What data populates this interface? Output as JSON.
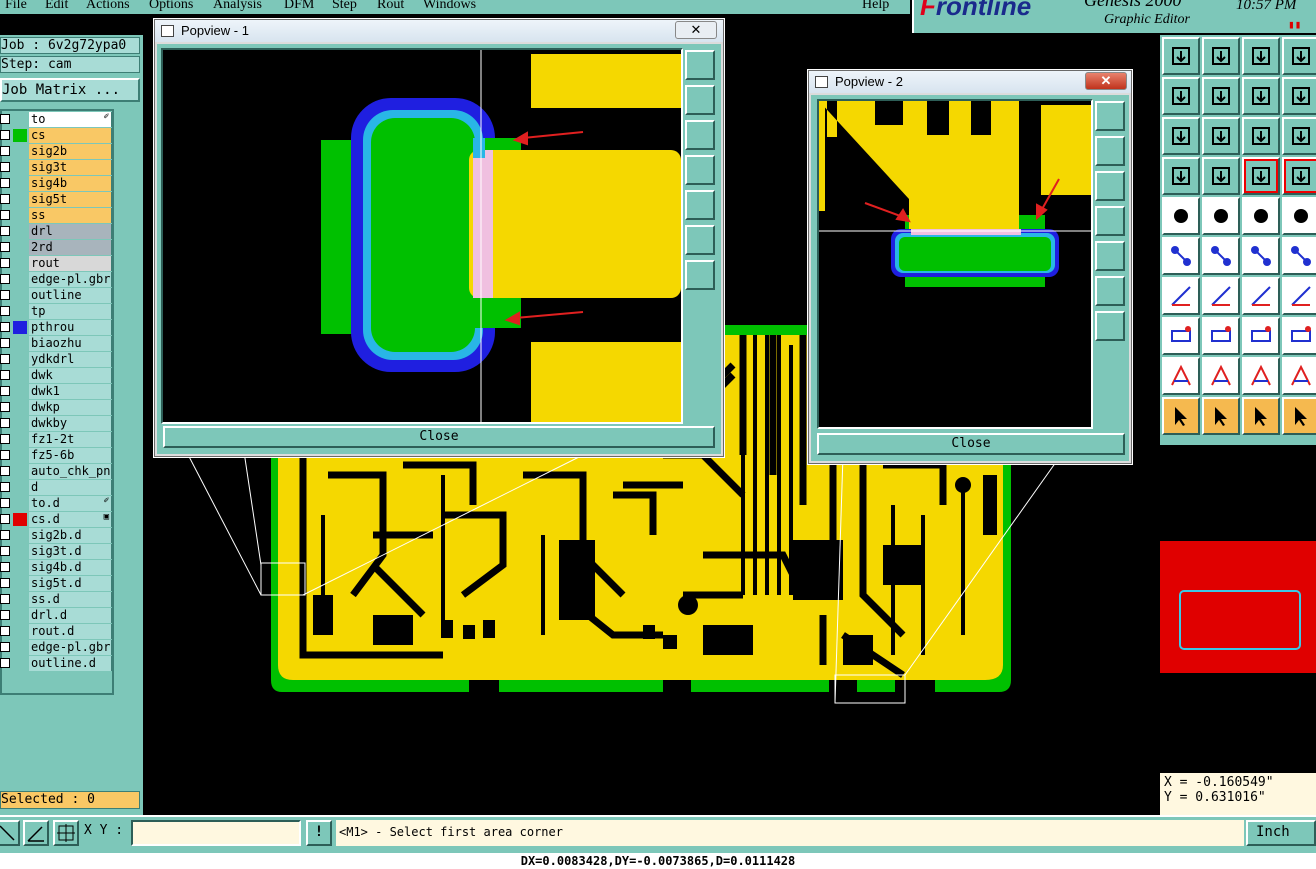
{
  "menu": [
    "File",
    "Edit",
    "Actions",
    "Options",
    "Analysis",
    "DFM",
    "Step",
    "Rout",
    "Windows",
    "Help"
  ],
  "logo": {
    "brand_red": "F",
    "brand_rest": "rontline",
    "product": "Genesis 2000",
    "subtitle": "Graphic Editor",
    "clock": "10:57 PM"
  },
  "job": {
    "job_label": "Job : 6v2g72ypa0",
    "step_label": "Step: cam",
    "matrix_button": "Job Matrix ..."
  },
  "layers": [
    {
      "name": "to",
      "color": "#7dc7b9",
      "bg": "#ffffff",
      "mark": "✐"
    },
    {
      "name": "cs",
      "color": "#00c000",
      "bg": "#f9c865",
      "mark": ""
    },
    {
      "name": "sig2b",
      "color": "#7dc7b9",
      "bg": "#f9c865",
      "mark": ""
    },
    {
      "name": "sig3t",
      "color": "#7dc7b9",
      "bg": "#f9c865",
      "mark": ""
    },
    {
      "name": "sig4b",
      "color": "#7dc7b9",
      "bg": "#f9c865",
      "mark": ""
    },
    {
      "name": "sig5t",
      "color": "#7dc7b9",
      "bg": "#f9c865",
      "mark": ""
    },
    {
      "name": "ss",
      "color": "#7dc7b9",
      "bg": "#f9c865",
      "mark": ""
    },
    {
      "name": "drl",
      "color": "#7dc7b9",
      "bg": "#a8b4bc",
      "mark": ""
    },
    {
      "name": "2rd",
      "color": "#7dc7b9",
      "bg": "#a8b4bc",
      "mark": ""
    },
    {
      "name": "rout",
      "color": "#7dc7b9",
      "bg": "#d8d8d8",
      "mark": ""
    },
    {
      "name": "edge-pl.gbr",
      "color": "#7dc7b9",
      "bg": "#a8dcd6",
      "mark": ""
    },
    {
      "name": "outline",
      "color": "#7dc7b9",
      "bg": "#a8dcd6",
      "mark": ""
    },
    {
      "name": "tp",
      "color": "#7dc7b9",
      "bg": "#a8dcd6",
      "mark": ""
    },
    {
      "name": "pthrou",
      "color": "#2020e0",
      "bg": "#a8dcd6",
      "mark": ""
    },
    {
      "name": "biaozhu",
      "color": "#7dc7b9",
      "bg": "#a8dcd6",
      "mark": ""
    },
    {
      "name": "ydkdrl",
      "color": "#7dc7b9",
      "bg": "#a8dcd6",
      "mark": ""
    },
    {
      "name": "dwk",
      "color": "#7dc7b9",
      "bg": "#a8dcd6",
      "mark": ""
    },
    {
      "name": "dwk1",
      "color": "#7dc7b9",
      "bg": "#a8dcd6",
      "mark": ""
    },
    {
      "name": "dwkp",
      "color": "#7dc7b9",
      "bg": "#a8dcd6",
      "mark": ""
    },
    {
      "name": "dwkby",
      "color": "#7dc7b9",
      "bg": "#a8dcd6",
      "mark": ""
    },
    {
      "name": "fz1-2t",
      "color": "#7dc7b9",
      "bg": "#a8dcd6",
      "mark": ""
    },
    {
      "name": "fz5-6b",
      "color": "#7dc7b9",
      "bg": "#a8dcd6",
      "mark": ""
    },
    {
      "name": "auto_chk_pn",
      "color": "#7dc7b9",
      "bg": "#a8dcd6",
      "mark": ""
    },
    {
      "name": "d",
      "color": "#7dc7b9",
      "bg": "#a8dcd6",
      "mark": ""
    },
    {
      "name": "to.d",
      "color": "#7dc7b9",
      "bg": "#a8dcd6",
      "mark": "✐"
    },
    {
      "name": "cs.d",
      "color": "#e00000",
      "bg": "#a8dcd6",
      "mark": "▣"
    },
    {
      "name": "sig2b.d",
      "color": "#7dc7b9",
      "bg": "#a8dcd6",
      "mark": ""
    },
    {
      "name": "sig3t.d",
      "color": "#7dc7b9",
      "bg": "#a8dcd6",
      "mark": ""
    },
    {
      "name": "sig4b.d",
      "color": "#7dc7b9",
      "bg": "#a8dcd6",
      "mark": ""
    },
    {
      "name": "sig5t.d",
      "color": "#7dc7b9",
      "bg": "#a8dcd6",
      "mark": ""
    },
    {
      "name": "ss.d",
      "color": "#7dc7b9",
      "bg": "#a8dcd6",
      "mark": ""
    },
    {
      "name": "drl.d",
      "color": "#7dc7b9",
      "bg": "#a8dcd6",
      "mark": ""
    },
    {
      "name": "rout.d",
      "color": "#7dc7b9",
      "bg": "#a8dcd6",
      "mark": ""
    },
    {
      "name": "edge-pl.gbr",
      "color": "#7dc7b9",
      "bg": "#a8dcd6",
      "mark": ""
    },
    {
      "name": "outline.d",
      "color": "#7dc7b9",
      "bg": "#a8dcd6",
      "mark": ""
    }
  ],
  "selected_label": "Selected : 0",
  "popview1": {
    "title": "Popview - 1",
    "close_label": "Close",
    "close_glyph": "✕"
  },
  "popview2": {
    "title": "Popview - 2",
    "close_label": "Close",
    "close_glyph": "✕"
  },
  "coords": {
    "x": "X = -0.160549\"",
    "y": "Y = 0.631016\""
  },
  "xy_label": "X Y :",
  "xy_value": "",
  "warn_glyph": "!",
  "prompt": "<M1> - Select first area corner",
  "units": "Inch",
  "status": "DX=0.0083428,DY=-0.0073865,D=0.0111428",
  "colors": {
    "panel": "#7dc7b9",
    "board": "#f5d800",
    "copper_edge": "#00c000",
    "mask": "#1f1fe0",
    "highlight": "#f9c865"
  },
  "toolbar_icons": [
    "zoom-in-icon",
    "zoom-out-icon",
    "home-icon",
    "zoom-fit-icon",
    "pan-left-icon",
    "pan-right-icon",
    "undo-view-icon",
    "redraw-icon",
    "fit-all-icon",
    "center-icon",
    "one-to-one-icon",
    "help-icon",
    "measure-icon",
    "grid-icon",
    "layer-net-icon",
    "layer-compare-icon",
    "feature-info-icon",
    "snap-icon",
    "ruler-icon",
    "pad-icon",
    "net-icon",
    "delete-icon",
    "move-icon",
    "add-pad-icon",
    "line-icon",
    "draw-line-icon",
    "arc-icon",
    "fill-icon",
    "add-polygon-icon",
    "cut-icon",
    "resize-icon",
    "copy-icon",
    "arc-draw-icon",
    "text-icon",
    "arch-icon",
    "dimension-icon",
    "select-icon",
    "select-feature-icon",
    "select-net-icon",
    "select-area-icon"
  ]
}
